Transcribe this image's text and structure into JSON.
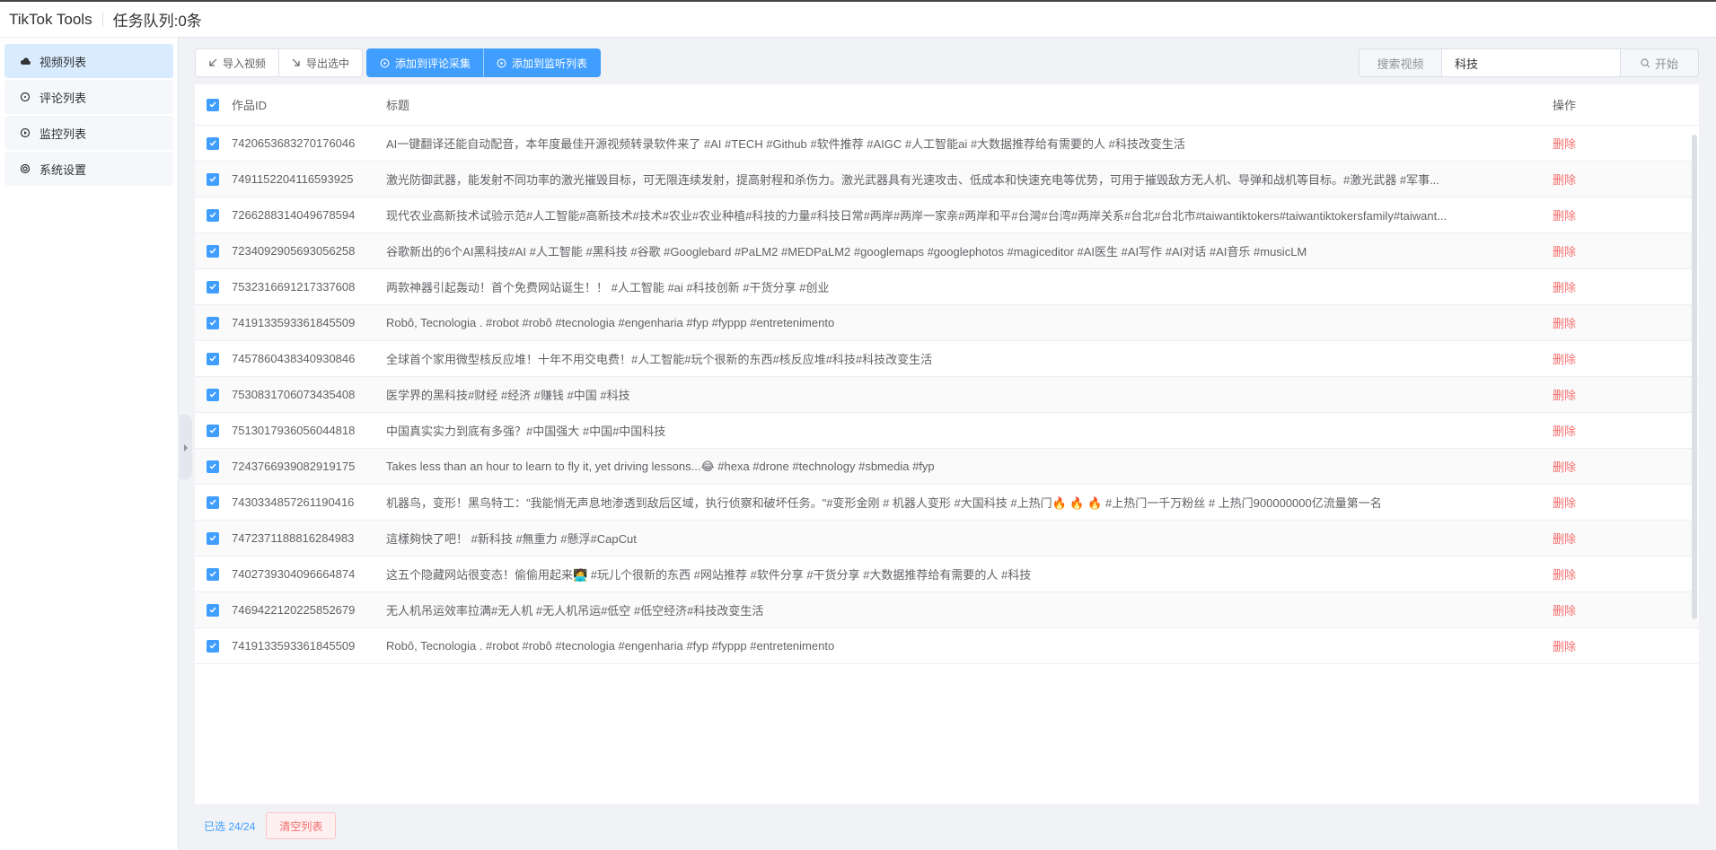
{
  "app": {
    "title": "TikTok Tools",
    "queue": "任务队列:0条"
  },
  "sidebar": {
    "items": [
      {
        "label": "视频列表",
        "icon": "cloud-icon",
        "active": true
      },
      {
        "label": "评论列表",
        "icon": "comment-icon",
        "active": false
      },
      {
        "label": "监控列表",
        "icon": "play-circle-icon",
        "active": false
      },
      {
        "label": "系统设置",
        "icon": "gear-icon",
        "active": false
      }
    ]
  },
  "toolbar": {
    "import_label": "导入视频",
    "export_label": "导出选中",
    "add_comment_label": "添加到评论采集",
    "add_monitor_label": "添加到监听列表"
  },
  "search": {
    "prefix": "搜索视频",
    "value": "科技",
    "button": "开始"
  },
  "table": {
    "headers": {
      "id": "作品ID",
      "title": "标题",
      "op": "操作"
    },
    "delete_label": "删除",
    "rows": [
      {
        "id": "7420653683270176046",
        "title": "AI一键翻译还能自动配音，本年度最佳开源视频转录软件来了 #AI #TECH #Github #软件推荐 #AIGC #人工智能ai #大数据推荐给有需要的人 #科技改变生活"
      },
      {
        "id": "7491152204116593925",
        "title": "激光防御武器，能发射不同功率的激光摧毁目标，可无限连续发射，提高射程和杀伤力。激光武器具有光速攻击、低成本和快速充电等优势，可用于摧毁敌方无人机、导弹和战机等目标。#激光武器 #军事..."
      },
      {
        "id": "7266288314049678594",
        "title": "现代农业高新技术试验示范#人工智能#高新技术#技术#农业#农业种植#科技的力量#科技日常#两岸#两岸一家亲#两岸和平#台灣#台湾#两岸关系#台北#台北市#taiwantiktokers#taiwantiktokersfamily#taiwant..."
      },
      {
        "id": "7234092905693056258",
        "title": "谷歌新出的6个AI黑科技#AI #人工智能 #黑科技 #谷歌 #Googlebard #PaLM2 #MEDPaLM2 #googlemaps #googlephotos #magiceditor #AI医生 #AI写作 #AI对话 #AI音乐 #musicLM"
      },
      {
        "id": "7532316691217337608",
        "title": "两款神器引起轰动！首个免费网站诞生！！ #人工智能 #ai #科技创新 #干货分享 #创业"
      },
      {
        "id": "7419133593361845509",
        "title": "Robô, Tecnologia . #robot #robô #tecnologia #engenharia #fyp #fyppp #entretenimento"
      },
      {
        "id": "7457860438340930846",
        "title": "全球首个家用微型核反应堆！十年不用交电费！#人工智能#玩个很新的东西#核反应堆#科技#科技改变生活"
      },
      {
        "id": "7530831706073435408",
        "title": "医学界的黑科技#财经 #经济 #赚钱 #中国 #科技"
      },
      {
        "id": "7513017936056044818",
        "title": "中国真实实力到底有多强？#中国强大 #中国#中国科技"
      },
      {
        "id": "7243766939082919175",
        "title": "Takes less than an hour to learn to fly it, yet driving lessons...😂 #hexa #drone #technology #sbmedia #fyp"
      },
      {
        "id": "7430334857261190416",
        "title": "机器鸟，变形！黑鸟特工：\"我能悄无声息地渗透到敌后区域，执行侦察和破坏任务。\"#变形金刚 # 机器人变形 #大国科技 #上热门🔥 🔥 🔥 #上热门一千万粉丝 # 上热门900000000亿流量第一名"
      },
      {
        "id": "7472371188816284983",
        "title": "這樣夠快了吧！ #新科技 #無重力 #懸浮#CapCut"
      },
      {
        "id": "7402739304096664874",
        "title": "这五个隐藏网站很变态！偷偷用起来🧑‍💻 #玩儿个很新的东西 #网站推荐 #软件分享 #干货分享 #大数据推荐给有需要的人 #科技"
      },
      {
        "id": "7469422120225852679",
        "title": "无人机吊运效率拉满#无人机 #无人机吊运#低空 #低空经济#科技改变生活"
      },
      {
        "id": "7419133593361845509",
        "title": "Robô, Tecnologia . #robot #robô #tecnologia #engenharia #fyp #fyppp #entretenimento"
      }
    ]
  },
  "footer": {
    "selected": "已选 24/24",
    "clear_label": "清空列表"
  },
  "colors": {
    "primary": "#409eff",
    "danger": "#f56c6c",
    "active_bg": "#d9ecff"
  }
}
